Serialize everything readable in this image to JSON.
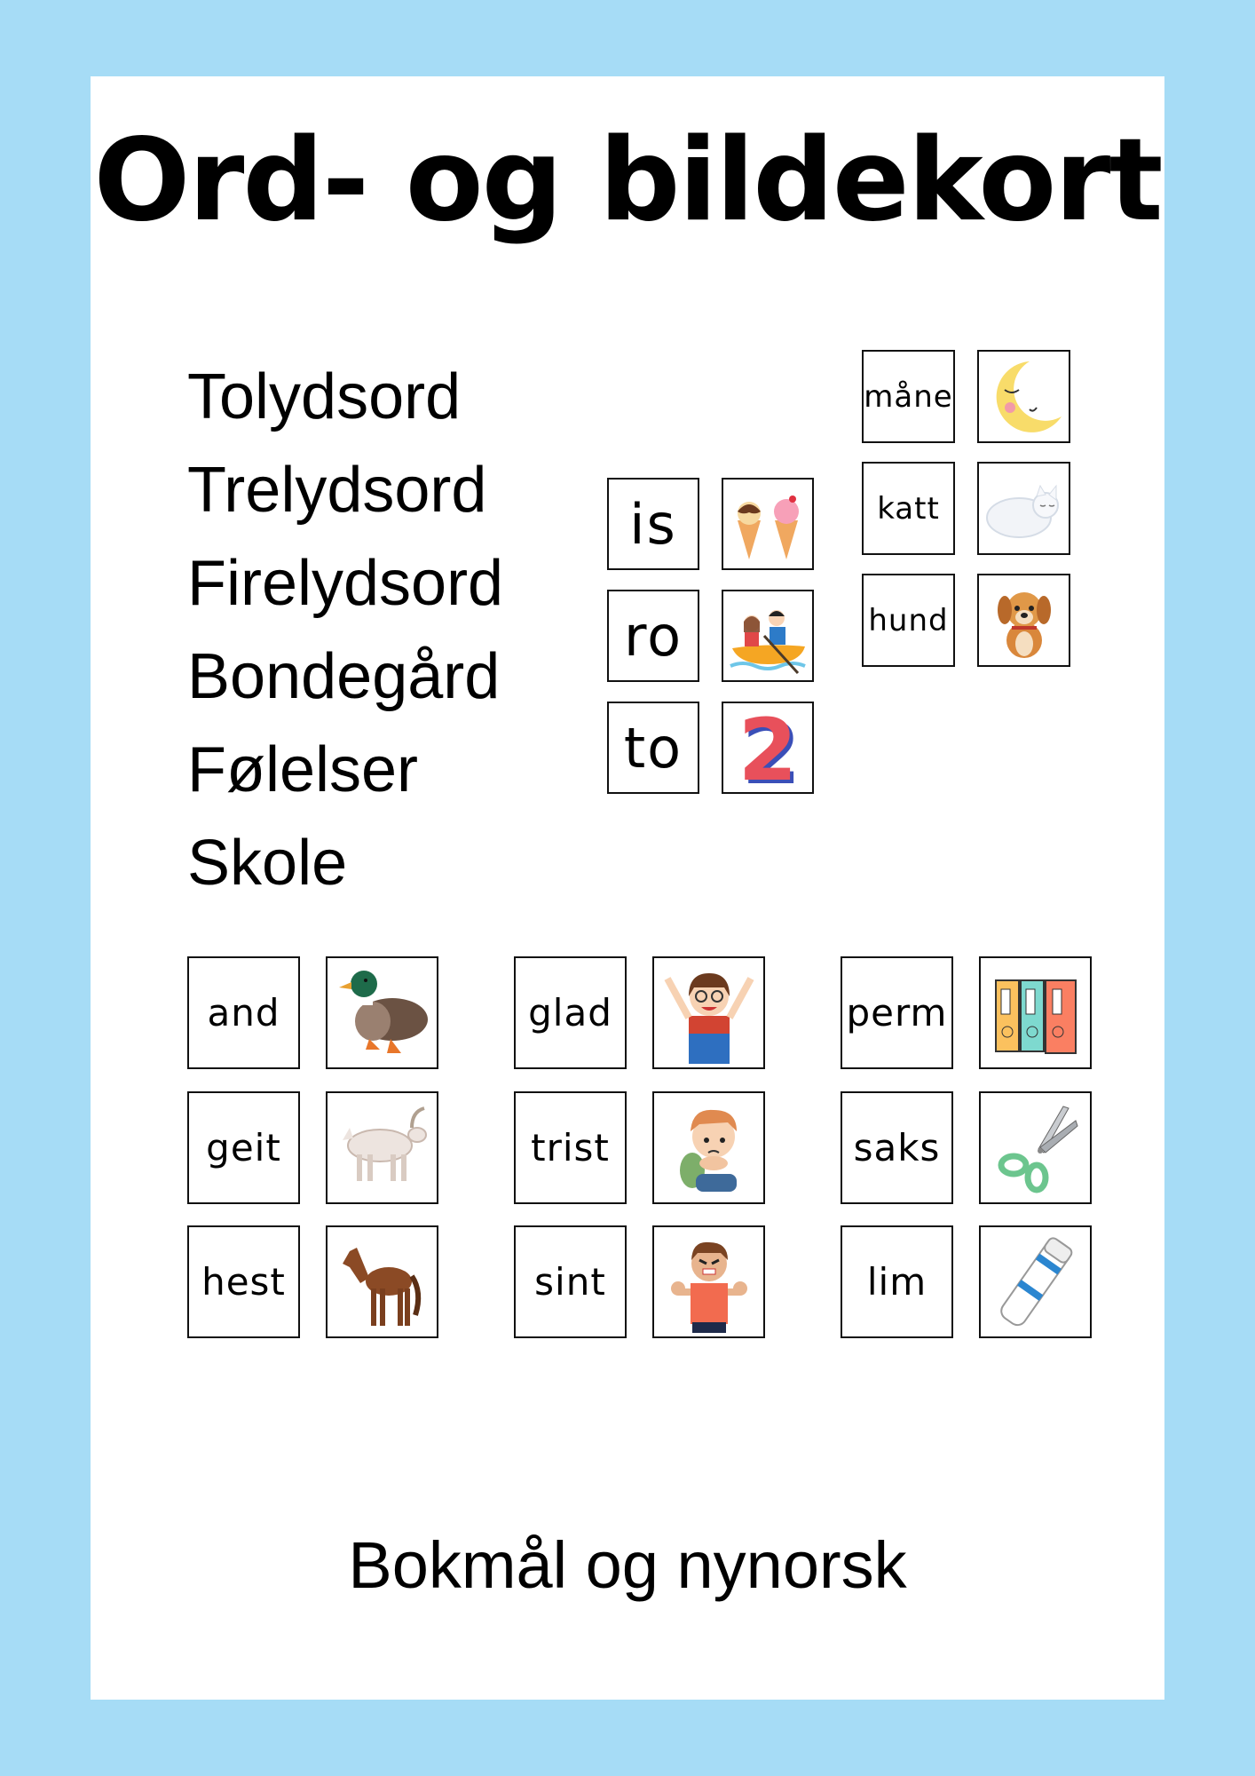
{
  "page": {
    "title": "Ord- og bildekort",
    "footer": "Bokmål og nynorsk",
    "colors": {
      "background": "#A6DCF6",
      "panel": "#FFFFFF",
      "text": "#000000"
    }
  },
  "topics": [
    "Tolydsord",
    "Trelydsord",
    "Firelydsord",
    "Bondegård",
    "Følelser",
    "Skole"
  ],
  "card_groups": {
    "tolydsord": [
      {
        "word": "is",
        "picture": "ice-cream-cones-icon"
      },
      {
        "word": "ro",
        "picture": "children-rowing-boat-icon"
      },
      {
        "word": "to",
        "picture": "number-two-icon"
      }
    ],
    "trelydsord": [
      {
        "word": "måne",
        "picture": "sleeping-moon-icon"
      },
      {
        "word": "katt",
        "picture": "sleeping-cat-icon"
      },
      {
        "word": "hund",
        "picture": "puppy-dog-icon"
      }
    ],
    "bondegard": [
      {
        "word": "and",
        "picture": "duck-icon"
      },
      {
        "word": "geit",
        "picture": "goat-icon"
      },
      {
        "word": "hest",
        "picture": "horse-icon"
      }
    ],
    "folelser": [
      {
        "word": "glad",
        "picture": "happy-girl-icon"
      },
      {
        "word": "trist",
        "picture": "sad-boy-icon"
      },
      {
        "word": "sint",
        "picture": "angry-boy-icon"
      }
    ],
    "skole": [
      {
        "word": "perm",
        "picture": "binders-icon"
      },
      {
        "word": "saks",
        "picture": "scissors-icon"
      },
      {
        "word": "lim",
        "picture": "glue-stick-icon"
      }
    ]
  }
}
